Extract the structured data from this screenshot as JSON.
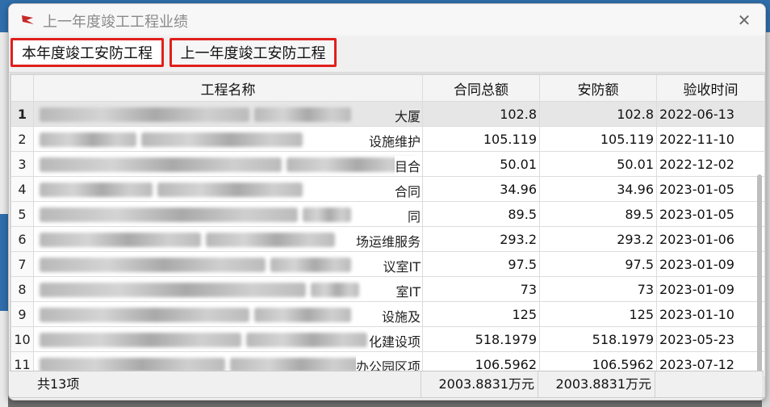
{
  "window": {
    "title": "上一年度竣工工程业绩"
  },
  "tabs": [
    {
      "label": "本年度竣工安防工程"
    },
    {
      "label": "上一年度竣工安防工程"
    }
  ],
  "table": {
    "headers": [
      "工程名称",
      "合同总额",
      "安防额",
      "验收时间"
    ],
    "rows": [
      {
        "no": "1",
        "name_visible": "大厦",
        "contract": "102.8",
        "security": "102.8",
        "date": "2022-06-13"
      },
      {
        "no": "2",
        "name_visible": "设施维护",
        "contract": "105.119",
        "security": "105.119",
        "date": "2022-11-10"
      },
      {
        "no": "3",
        "name_visible": "目合",
        "contract": "50.01",
        "security": "50.01",
        "date": "2022-12-02"
      },
      {
        "no": "4",
        "name_visible": "合同",
        "contract": "34.96",
        "security": "34.96",
        "date": "2023-01-05"
      },
      {
        "no": "5",
        "name_visible": "同",
        "contract": "89.5",
        "security": "89.5",
        "date": "2023-01-05"
      },
      {
        "no": "6",
        "name_visible": "场运维服务",
        "contract": "293.2",
        "security": "293.2",
        "date": "2023-01-06"
      },
      {
        "no": "7",
        "name_visible": "议室IT",
        "contract": "97.5",
        "security": "97.5",
        "date": "2023-01-09"
      },
      {
        "no": "8",
        "name_visible": "室IT",
        "contract": "73",
        "security": "73",
        "date": "2023-01-09"
      },
      {
        "no": "9",
        "name_visible": "设施及",
        "contract": "125",
        "security": "125",
        "date": "2023-01-10"
      },
      {
        "no": "10",
        "name_visible": "化建设项",
        "contract": "518.1979",
        "security": "518.1979",
        "date": "2023-05-23"
      },
      {
        "no": "11",
        "name_visible": "办公园区项",
        "contract": "106.5962",
        "security": "106.5962",
        "date": "2023-07-12"
      }
    ]
  },
  "footer": {
    "total_label": "共13项",
    "contract_sum": "2003.8831万元",
    "security_sum": "2003.8831万元"
  },
  "colors": {
    "tab_highlight": "#e0201c",
    "selected_row": "#e6e6e6"
  }
}
